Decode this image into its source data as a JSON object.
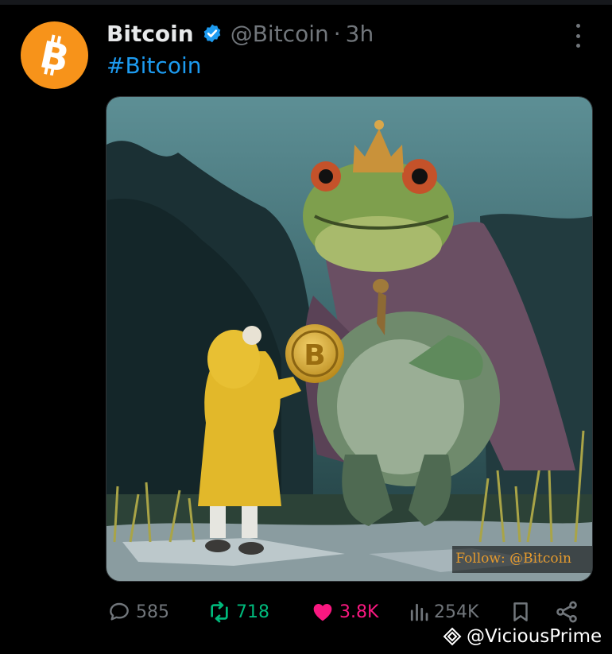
{
  "post": {
    "author_name": "Bitcoin",
    "author_handle": "@Bitcoin",
    "separator": "·",
    "timestamp": "3h",
    "text": "#Bitcoin",
    "image_watermark": "Follow: @Bitcoin"
  },
  "actions": {
    "replies": "585",
    "reposts": "718",
    "likes": "3.8K",
    "views": "254K"
  },
  "credit": {
    "text": "@ViciousPrime"
  },
  "icons": {
    "avatar": "bitcoin-logo",
    "verified": "verified-badge-icon",
    "more": "more-vertical-icon",
    "reply": "reply-bubble-icon",
    "repost": "repost-icon",
    "like": "heart-icon",
    "views": "bar-chart-icon",
    "bookmark": "bookmark-icon",
    "share": "share-icon",
    "credit": "diamond-logo-icon"
  },
  "colors": {
    "background": "#000000",
    "text_primary": "#e7e9ea",
    "text_secondary": "#71767b",
    "link": "#1d9bf0",
    "bitcoin_orange": "#f7931a",
    "repost_green": "#00ba7c",
    "like_pink": "#f91880"
  }
}
